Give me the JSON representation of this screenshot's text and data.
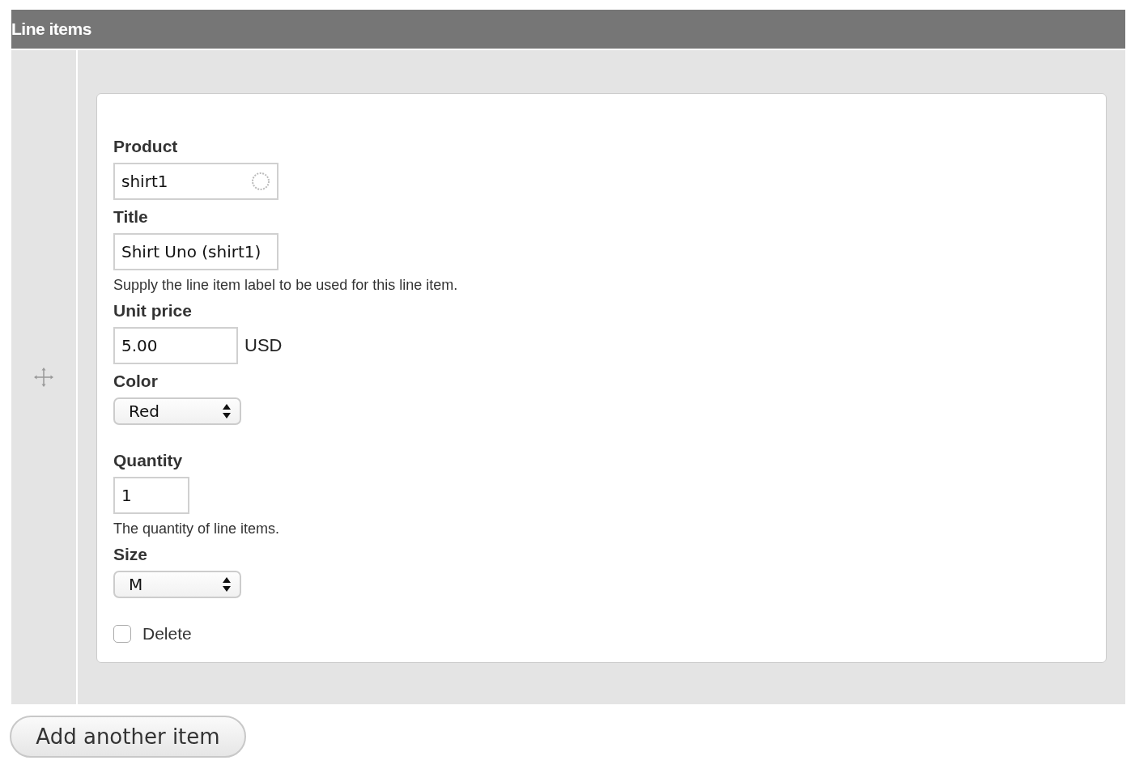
{
  "section": {
    "title": "Line items"
  },
  "line_item": {
    "fields": [
      {
        "kind": "autocomplete",
        "label": "Product",
        "value": "shirt1"
      },
      {
        "kind": "text",
        "label": "Title",
        "value": "Shirt Uno (shirt1)",
        "description": "Supply the line item label to be used for this line item."
      },
      {
        "kind": "price",
        "label": "Unit price",
        "value": "5.00",
        "currency": "USD"
      },
      {
        "kind": "select",
        "label": "Color",
        "value": "Red"
      },
      {
        "kind": "number",
        "label": "Quantity",
        "value": "1",
        "description": "The quantity of line items."
      },
      {
        "kind": "select",
        "label": "Size",
        "value": "M"
      }
    ],
    "delete": {
      "label": "Delete",
      "checked": false
    }
  },
  "add_button": {
    "label": "Add another item"
  }
}
